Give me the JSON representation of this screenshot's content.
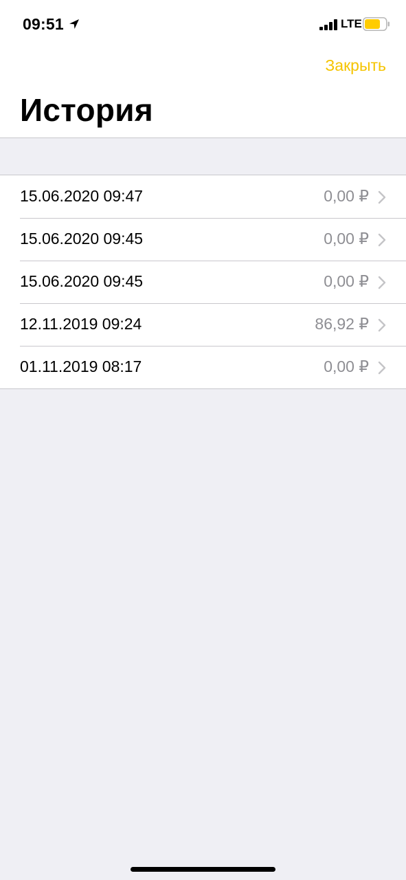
{
  "status_bar": {
    "time": "09:51",
    "network": "LTE",
    "battery_color": "#ffcc00",
    "location_icon": "location-arrow-icon",
    "signal_icon": "cellular-signal-icon",
    "battery_icon": "battery-icon"
  },
  "header": {
    "close_label": "Закрыть",
    "title": "История",
    "accent_color": "#f5c400"
  },
  "history": {
    "rows": [
      {
        "date": "15.06.2020 09:47",
        "amount": "0,00 ₽"
      },
      {
        "date": "15.06.2020 09:45",
        "amount": "0,00 ₽"
      },
      {
        "date": "15.06.2020 09:45",
        "amount": "0,00 ₽"
      },
      {
        "date": "12.11.2019 09:24",
        "amount": "86,92 ₽"
      },
      {
        "date": "01.11.2019 08:17",
        "amount": "0,00 ₽"
      }
    ],
    "row_icon": "chevron-right-icon"
  }
}
